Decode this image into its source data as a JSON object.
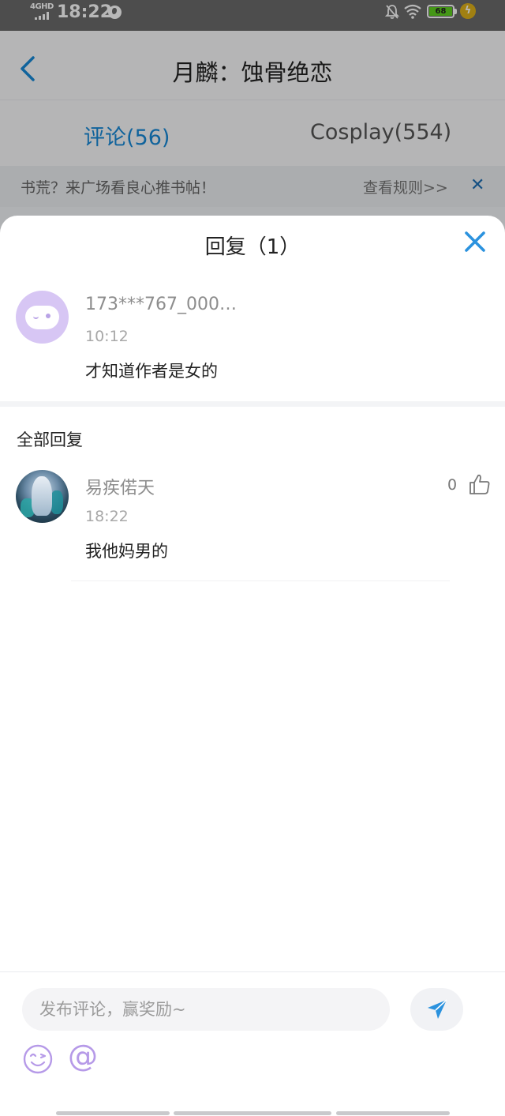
{
  "status_bar": {
    "network": "4GHD",
    "time": "18:22",
    "battery": "68",
    "icons": [
      "globe-icon",
      "notifications-off-icon",
      "wifi-icon",
      "battery-icon",
      "charging-icon"
    ]
  },
  "header": {
    "title": "月麟：蚀骨绝恋",
    "tabs": [
      {
        "label": "评论(56)",
        "active": true
      },
      {
        "label": "Cosplay(554)",
        "active": false
      }
    ]
  },
  "notice": {
    "text": "书荒？来广场看良心推书帖！",
    "link": "查看规则>>"
  },
  "sheet": {
    "title": "回复（1）",
    "original_comment": {
      "username": "173***767_000…",
      "time": "10:12",
      "content": "才知道作者是女的"
    },
    "all_replies_label": "全部回复",
    "replies": [
      {
        "username": "易疾偌天",
        "time": "18:22",
        "content": "我他妈男的",
        "likes": "0"
      }
    ]
  },
  "input_bar": {
    "placeholder": "发布评论，赢奖励~",
    "at_symbol": "@"
  },
  "colors": {
    "accent": "#1789d8",
    "close_x": "#2b92de",
    "battery": "#5fd21f",
    "icon_purple": "#b69ae8"
  }
}
